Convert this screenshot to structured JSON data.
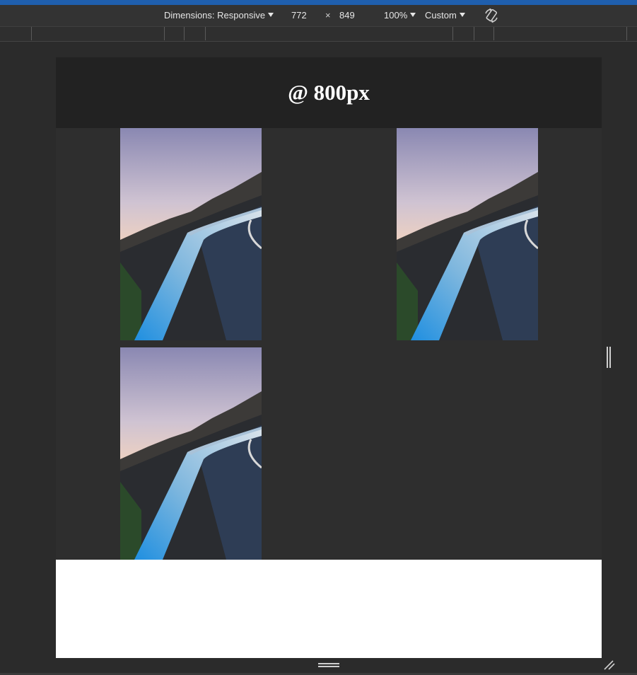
{
  "toolbar": {
    "dimensions_label": "Dimensions: Responsive",
    "width_value": "772",
    "times_sign": "×",
    "height_value": "849",
    "zoom_label": "100%",
    "throttle_label": "Custom",
    "rotate_icon": "rotate-icon"
  },
  "page": {
    "heading": "@ 800px",
    "images": [
      {
        "name": "road-railing-photo-1"
      },
      {
        "name": "road-railing-photo-2"
      },
      {
        "name": "road-railing-photo-3"
      }
    ]
  },
  "colors": {
    "accent_top": "#1f5fae",
    "page_background": "#2e2e2e",
    "header_background": "#222222"
  }
}
